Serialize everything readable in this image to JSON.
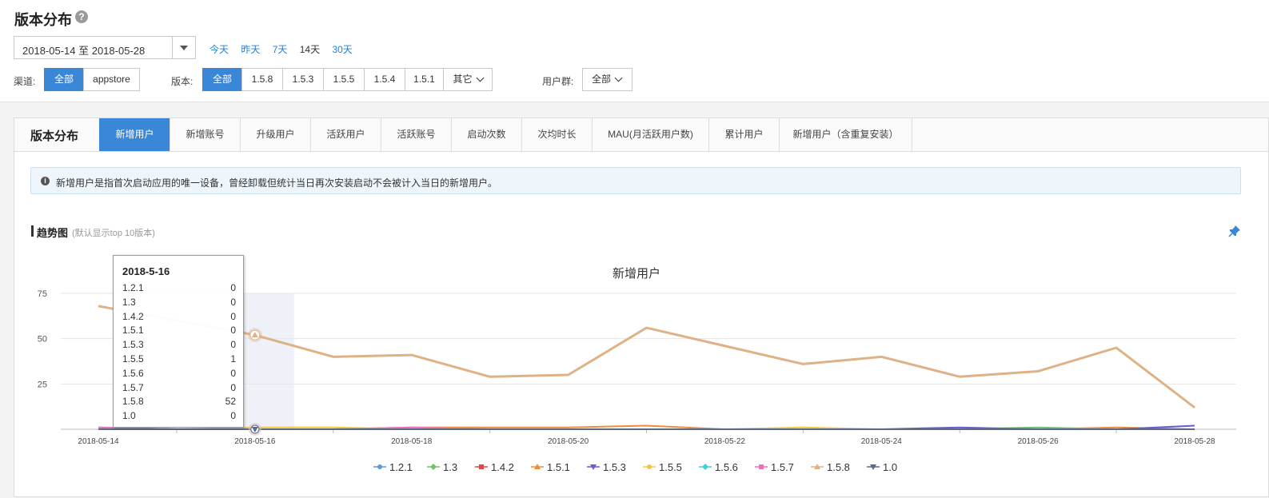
{
  "header": {
    "title": "版本分布",
    "help_icon": "question-icon",
    "date_range": "2018-05-14 至 2018-05-28",
    "quick_ranges": [
      "今天",
      "昨天",
      "7天",
      "14天",
      "30天"
    ],
    "quick_active": "14天"
  },
  "filters": {
    "channel_label": "渠道:",
    "channels": [
      "全部",
      "appstore"
    ],
    "version_label": "版本:",
    "versions": [
      "全部",
      "1.5.8",
      "1.5.3",
      "1.5.5",
      "1.5.4",
      "1.5.1",
      "其它"
    ],
    "group_label": "用户群:",
    "group_value": "全部"
  },
  "panel": {
    "title": "版本分布",
    "tabs": [
      "新增用户",
      "新增账号",
      "升级用户",
      "活跃用户",
      "活跃账号",
      "启动次数",
      "次均时长",
      "MAU(月活跃用户数)",
      "累计用户",
      "新增用户（含重复安装）"
    ],
    "active_tab": "新增用户",
    "info": "新增用户是指首次启动应用的唯一设备，曾经卸载但统计当日再次安装启动不会被计入当日的新增用户。",
    "trend_title": "趋势图",
    "trend_sub": "(默认显示top 10版本)"
  },
  "tooltip": {
    "date": "2018-5-16",
    "rows": [
      {
        "name": "1.2.1",
        "value": "0"
      },
      {
        "name": "1.3",
        "value": "0"
      },
      {
        "name": "1.4.2",
        "value": "0"
      },
      {
        "name": "1.5.1",
        "value": "0"
      },
      {
        "name": "1.5.3",
        "value": "0"
      },
      {
        "name": "1.5.5",
        "value": "1"
      },
      {
        "name": "1.5.6",
        "value": "0"
      },
      {
        "name": "1.5.7",
        "value": "0"
      },
      {
        "name": "1.5.8",
        "value": "52"
      },
      {
        "name": "1.0",
        "value": "0"
      }
    ]
  },
  "chart_data": {
    "type": "line",
    "title": "新增用户",
    "x": [
      "2018-05-14",
      "2018-05-15",
      "2018-05-16",
      "2018-05-17",
      "2018-05-18",
      "2018-05-19",
      "2018-05-20",
      "2018-05-21",
      "2018-05-22",
      "2018-05-23",
      "2018-05-24",
      "2018-05-25",
      "2018-05-26",
      "2018-05-27",
      "2018-05-28"
    ],
    "x_tick_labels": [
      "2018-05-14",
      "2018-05-16",
      "2018-05-18",
      "2018-05-20",
      "2018-05-22",
      "2018-05-24",
      "2018-05-26",
      "2018-05-28"
    ],
    "ylim": [
      0,
      75
    ],
    "y_ticks": [
      25,
      50,
      75
    ],
    "grid": true,
    "legend": "bottom",
    "highlight_x": "2018-05-16",
    "series": [
      {
        "name": "1.2.1",
        "color": "#5b9bd5",
        "marker": "circle",
        "values": [
          1,
          0,
          0,
          0,
          0,
          0,
          0,
          0,
          0,
          0,
          0,
          0,
          0,
          0,
          0
        ]
      },
      {
        "name": "1.3",
        "color": "#6cc36c",
        "marker": "diamond",
        "values": [
          0,
          0,
          0,
          0,
          0,
          0,
          0,
          0,
          0,
          0,
          0,
          0,
          1,
          0,
          0
        ]
      },
      {
        "name": "1.4.2",
        "color": "#e04545",
        "marker": "square",
        "values": [
          0,
          0,
          0,
          0,
          0,
          0,
          0,
          0,
          0,
          0,
          0,
          0,
          0,
          0,
          0
        ]
      },
      {
        "name": "1.5.1",
        "color": "#f08b3a",
        "marker": "triangle",
        "values": [
          0,
          0,
          0,
          0,
          1,
          1,
          1,
          2,
          0,
          0,
          0,
          0,
          0,
          1,
          0
        ]
      },
      {
        "name": "1.5.3",
        "color": "#6a5acd",
        "marker": "triangle-down",
        "values": [
          0,
          0,
          0,
          0,
          0,
          0,
          0,
          0,
          0,
          0,
          0,
          1,
          0,
          0,
          2
        ]
      },
      {
        "name": "1.5.5",
        "color": "#f5c542",
        "marker": "circle",
        "values": [
          0,
          0,
          1,
          1,
          0,
          0,
          0,
          0,
          0,
          1,
          0,
          0,
          0,
          0,
          0
        ]
      },
      {
        "name": "1.5.6",
        "color": "#3fd3d3",
        "marker": "diamond",
        "values": [
          0,
          0,
          0,
          0,
          0,
          0,
          0,
          0,
          0,
          0,
          0,
          0,
          0,
          0,
          0
        ]
      },
      {
        "name": "1.5.7",
        "color": "#f06eb4",
        "marker": "square",
        "values": [
          1,
          0,
          0,
          0,
          1,
          0,
          0,
          0,
          0,
          0,
          0,
          0,
          0,
          0,
          0
        ]
      },
      {
        "name": "1.5.8",
        "color": "#deb285",
        "marker": "triangle",
        "values": [
          68,
          60,
          52,
          40,
          41,
          29,
          30,
          56,
          46,
          36,
          40,
          29,
          32,
          45,
          12
        ]
      },
      {
        "name": "1.0",
        "color": "#5a6b8c",
        "marker": "triangle-down",
        "values": [
          0,
          0,
          0,
          0,
          0,
          0,
          0,
          0,
          0,
          0,
          0,
          0,
          0,
          0,
          0
        ]
      }
    ]
  }
}
